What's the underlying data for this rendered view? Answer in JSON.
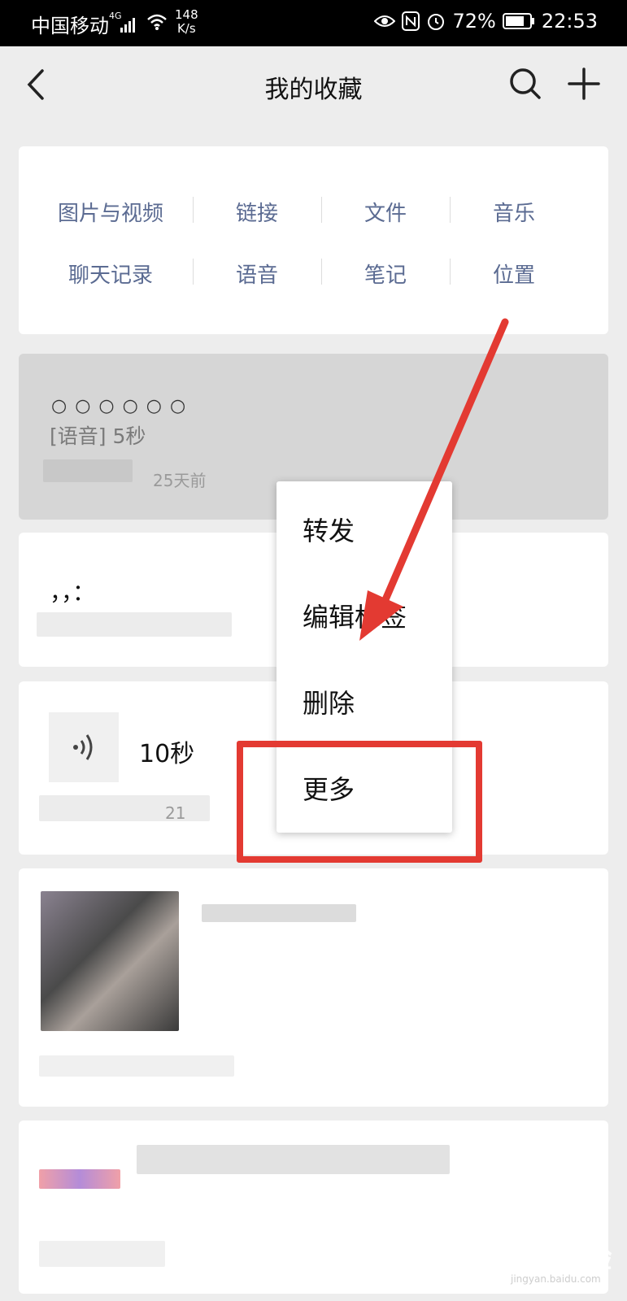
{
  "status_bar": {
    "carrier": "中国移动",
    "network_gen": "4G",
    "speed_value": "148",
    "speed_unit": "K/s",
    "battery": "72%",
    "time": "22:53"
  },
  "nav": {
    "title": "我的收藏"
  },
  "categories": [
    {
      "label": "图片与视频"
    },
    {
      "label": "链接"
    },
    {
      "label": "文件"
    },
    {
      "label": "音乐"
    },
    {
      "label": "聊天记录"
    },
    {
      "label": "语音"
    },
    {
      "label": "笔记"
    },
    {
      "label": "位置"
    }
  ],
  "items": {
    "selected": {
      "dots": "○○○○○○",
      "label": "[语音] 5秒",
      "meta": "25天前"
    },
    "text_item": {
      "snippet": "，，："
    },
    "voice_item": {
      "duration": "10秒",
      "meta": "21"
    }
  },
  "context_menu": {
    "items": [
      {
        "label": "转发"
      },
      {
        "label": "编辑标签"
      },
      {
        "label": "删除"
      },
      {
        "label": "更多"
      }
    ]
  },
  "annotation": {
    "arrow_color": "#e33a32",
    "box_color": "#e33a32"
  },
  "watermark": {
    "text": "Bai度经验",
    "sub": "jingyan.baidu.com"
  },
  "colors": {
    "category_text": "#5b6b92",
    "background": "#ededed",
    "selected_card": "#d6d6d6"
  }
}
